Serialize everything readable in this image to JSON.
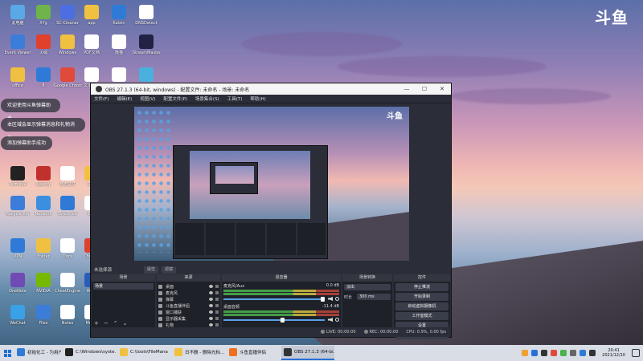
{
  "desktop": {
    "brand_logo": "斗鱼",
    "icons": [
      {
        "label": "此电脑",
        "color": "#5aa9e6"
      },
      {
        "label": "XYg",
        "color": "#6fb34b"
      },
      {
        "label": "SC-Cleaner",
        "color": "#4b6fe0"
      },
      {
        "label": "app",
        "color": "#f0c040"
      },
      {
        "label": "Kaixin",
        "color": "#2f7ad6"
      },
      {
        "label": "DNSDetect",
        "color": "#ffffff"
      },
      {
        "label": "Event Viewer",
        "color": "#3b7dd8"
      },
      {
        "label": "火绒",
        "color": "#e0402c"
      },
      {
        "label": "Windows",
        "color": "#f0c040"
      },
      {
        "label": "PDF文档",
        "color": "#ffffff"
      },
      {
        "label": "熊猫",
        "color": "#ffffff"
      },
      {
        "label": "StreamMaster",
        "color": "#222244"
      },
      {
        "label": "office",
        "color": "#f0c040"
      },
      {
        "label": "8",
        "color": "#2f7ad6"
      },
      {
        "label": "Google Chrome",
        "color": "#e04a3a"
      },
      {
        "label": "文本文档",
        "color": "#ffffff"
      },
      {
        "label": "Mozilla",
        "color": "#ffffff"
      },
      {
        "label": "V",
        "color": "#4ab0e0"
      },
      {
        "label": "Terminal",
        "color": "#222222"
      },
      {
        "label": "Speccy",
        "color": "#c0302c"
      },
      {
        "label": "日志文件",
        "color": "#ffffff"
      },
      {
        "label": "文件",
        "color": "#f0c040"
      },
      {
        "label": "Recycle Bin",
        "color": "#3b7dd8"
      },
      {
        "label": "Network",
        "color": "#3b8fe0"
      },
      {
        "label": "OneDrive",
        "color": "#2f7ad6"
      },
      {
        "label": "Log",
        "color": "#ffffff"
      },
      {
        "label": "VPN",
        "color": "#2f7ad6"
      },
      {
        "label": "Folder",
        "color": "#f0c040"
      },
      {
        "label": "Docs",
        "color": "#ffffff"
      },
      {
        "label": "Chrome",
        "color": "#e0402c"
      },
      {
        "label": "OneNote",
        "color": "#6f4bb3"
      },
      {
        "label": "NVIDIA",
        "color": "#76b900"
      },
      {
        "label": "CheatEngine",
        "color": "#ffffff"
      },
      {
        "label": "Word",
        "color": "#2b5bb8"
      },
      {
        "label": "WeChat",
        "color": "#3aa0e8"
      },
      {
        "label": "Files",
        "color": "#3b7dd8"
      },
      {
        "label": "Notes",
        "color": "#ffffff"
      },
      {
        "label": "Media",
        "color": "#ffffff"
      }
    ],
    "toasts": [
      "欢迎使用斗鱼弹幕助手",
      "本区域会显示弹幕消息和礼物消息",
      "添加弹幕助手成功"
    ]
  },
  "obs": {
    "title": "OBS 27.1.3 (64-bit, windows) - 配置文件: 未命名 - 场景: 未命名",
    "window_controls": {
      "minimize": "—",
      "maximize": "☐",
      "close": "✕"
    },
    "menu": [
      "文件(F)",
      "编辑(E)",
      "视图(V)",
      "配置文件(P)",
      "场景集合(S)",
      "工具(T)",
      "帮助(H)"
    ],
    "preview_logo": "斗鱼",
    "scene_bar": {
      "label": "未选择源",
      "props": "属性",
      "filters": "滤镜"
    },
    "docks": {
      "scenes": {
        "title": "场景",
        "items": [
          "场景"
        ]
      },
      "sources": {
        "title": "来源",
        "items": [
          "桌面",
          "麦克风",
          "弹幕",
          "斗鱼直播伴侣",
          "窗口捕获",
          "显示器采集",
          "礼物"
        ]
      },
      "mixer": {
        "title": "混音器",
        "channels": [
          {
            "name": "麦克风/Aux",
            "level": "0.0 dB"
          },
          {
            "name": "桌面音频",
            "level": "-11.4 dB"
          }
        ]
      },
      "transitions": {
        "title": "场景转换",
        "type": "淡出",
        "duration_label": "时长",
        "duration": "300 ms"
      },
      "controls": {
        "title": "控件",
        "buttons": [
          "停止推流",
          "开始录制",
          "启动虚拟摄像机",
          "工作室模式",
          "设置",
          "退出"
        ]
      }
    },
    "status": {
      "live": "LIVE: 00:00:00",
      "rec": "REC: 00:00:00",
      "cpu": "CPU: 0.9%, 0.00 fps"
    }
  },
  "taskbar": {
    "items": [
      {
        "label": "初始化工 - 为用户...",
        "color": "#2f7ad6"
      },
      {
        "label": "C:\\Windows\\syste...",
        "color": "#222222"
      },
      {
        "label": "C:\\tools\\FileMana",
        "color": "#f0c040"
      },
      {
        "label": "日不删 - 删除光标...",
        "color": "#f0c040"
      },
      {
        "label": "斗鱼直播伴侣",
        "color": "#f07020"
      },
      {
        "label": "OBS 27.1.3 (64-bi...",
        "color": "#333333"
      }
    ],
    "tray_colors": [
      "#f0a030",
      "#2a6fd6",
      "#333333",
      "#e04a3a",
      "#4bb34b",
      "#666666",
      "#2f7ad6",
      "#333333"
    ],
    "time": "20:41",
    "date": "2021/12/10"
  }
}
